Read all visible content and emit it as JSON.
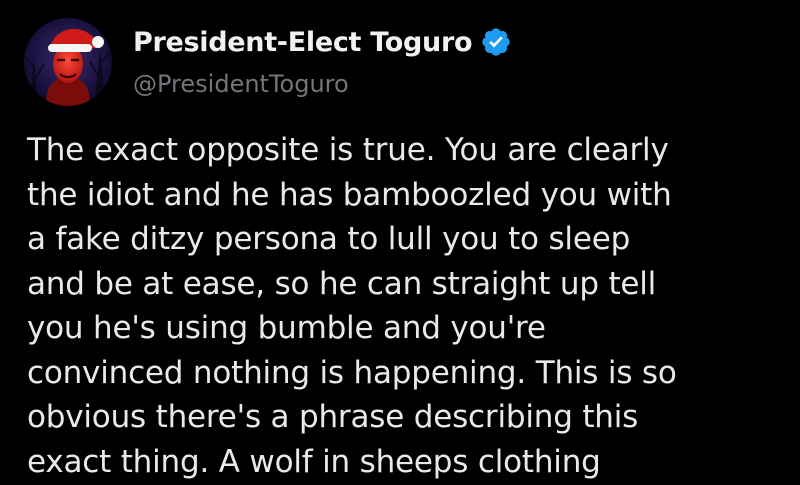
{
  "author": {
    "display_name": "President-Elect Toguro",
    "handle": "@PresidentToguro",
    "verified": true,
    "avatar_icon": "avatar-santa-hat-portrait",
    "verified_icon": "verified-check-badge-icon",
    "badge_color": "#1d9bf0"
  },
  "tweet": {
    "lines": [
      "The exact opposite is true. You are clearly",
      "the idiot and he has bamboozled you with",
      "a fake ditzy persona to lull you to sleep",
      "and be at ease, so he can straight up tell",
      "you he's using bumble and you're",
      "convinced nothing is happening. This is so",
      "obvious there's a phrase describing this",
      "exact thing. A wolf in sheeps clothing"
    ]
  },
  "colors": {
    "background": "#000000",
    "text": "#e7e9ea",
    "secondary_text": "#71767b"
  }
}
